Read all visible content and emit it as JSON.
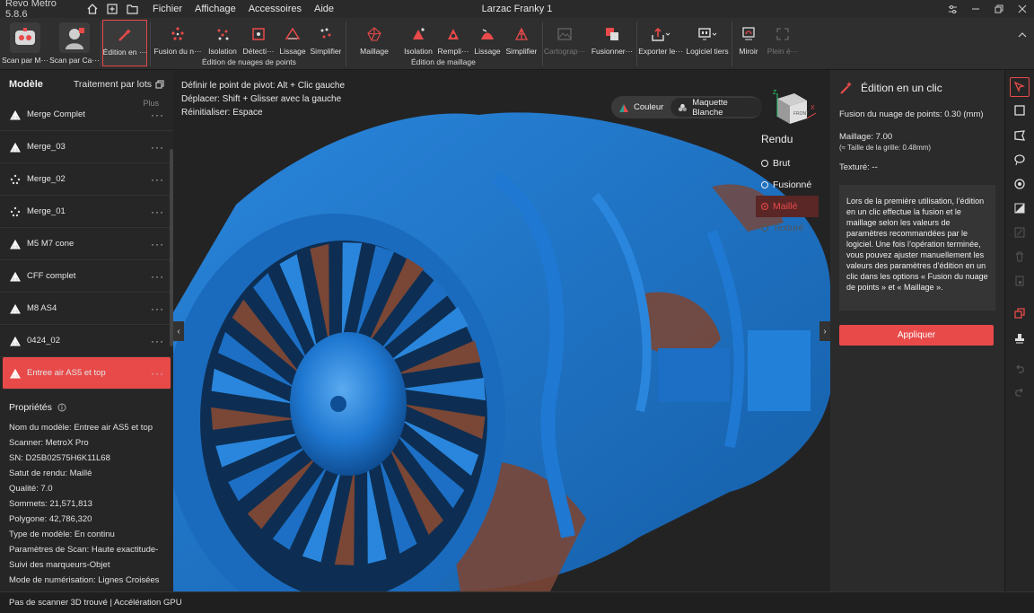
{
  "app": {
    "name": "Revo Metro 5.8.6",
    "project": "Larzac Franky 1"
  },
  "menus": [
    "Fichier",
    "Affichage",
    "Accessoires",
    "Aide"
  ],
  "toolbar": {
    "scan_models": [
      "Scan par M···",
      "Scan par Ca···"
    ],
    "edit_one_click": "Édition en ···",
    "pointcloud_tools": [
      "Fusion du n···",
      "Isolation",
      "Détecti···",
      "Lissage",
      "Simplifier"
    ],
    "pointcloud_group": "Édition de nuages de points",
    "mesh_tools": [
      "Maillage",
      "Isolation",
      "Rempli···",
      "Lissage",
      "Simplifier"
    ],
    "mesh_group": "Édition de maillage",
    "other_tools": [
      "Cartograp···",
      "Fusionner···",
      "Exporter le···",
      "Logiciel tiers",
      "Miroir",
      "Plein é···"
    ]
  },
  "left_panel": {
    "title": "Modèle",
    "batch": "Traitement par lots",
    "more": "Plus",
    "models": [
      {
        "name": "Merge Complet",
        "kind": "mesh"
      },
      {
        "name": "Merge_03",
        "kind": "mesh"
      },
      {
        "name": "Merge_02",
        "kind": "points"
      },
      {
        "name": "Merge_01",
        "kind": "points"
      },
      {
        "name": "M5 M7 cone",
        "kind": "mesh"
      },
      {
        "name": "CFF complet",
        "kind": "mesh"
      },
      {
        "name": "M8 AS4",
        "kind": "mesh"
      },
      {
        "name": "0424_02",
        "kind": "mesh"
      },
      {
        "name": "Entree air AS5 et top",
        "kind": "mesh",
        "selected": true
      }
    ],
    "more_dots": "···",
    "properties_title": "Propriétés",
    "properties": [
      "Nom du modèle:  Entree air AS5 et top",
      "Scanner:  MetroX Pro",
      "SN:  D25B02575H6K11L68",
      "Satut de rendu:  Maillé",
      "Qualité:  7.0",
      "Sommets:  21,571,813",
      "Polygone:  42,786,320",
      "Type de modèle:  En continu",
      "Paramètres de Scan:  Haute exactitude-Suivi des marqueurs-Objet",
      "Mode de numérisation:  Lignes Croisées"
    ]
  },
  "viewport": {
    "hints": [
      "Définir le point de pivot: Alt + Clic gauche",
      "Déplacer: Shift + Glisser avec la gauche",
      "Réinitialiser: Espace"
    ],
    "color_options": [
      "Couleur",
      "Maquette Blanche"
    ],
    "render_title": "Rendu",
    "render_options": [
      "Brut",
      "Fusionné",
      "Maillé",
      "Texturé"
    ],
    "render_selected": "Maillé",
    "cube_label": "FRONT",
    "axis_x": "X",
    "axis_z": "Z",
    "mesh_color": "#1f78d1",
    "rust_color": "#7a4636"
  },
  "right_panel": {
    "title": "Édition en un clic",
    "pointcloud_fusion": "Fusion du nuage de points:  0.30 (mm)",
    "mesh": "Maillage:  7.00",
    "grid_size": "(≈ Taille de la grille: 0.48mm)",
    "texture": "Texturé: --",
    "description": "Lors de la première utilisation, l’édition en un clic effectue la fusion et le maillage selon les valeurs de paramètres recommandées par le logiciel. Une fois l’opération terminée, vous pouvez ajuster manuellement les valeurs des paramètres d’édition en un clic dans les options « Fusion du nuage de points » et « Maillage ».",
    "apply": "Appliquer"
  },
  "status": {
    "text": "Pas de scanner 3D trouvé  | Accélération GPU"
  },
  "colors": {
    "accent": "#e84a4a",
    "panel": "#262626",
    "viewport": "#232323"
  }
}
